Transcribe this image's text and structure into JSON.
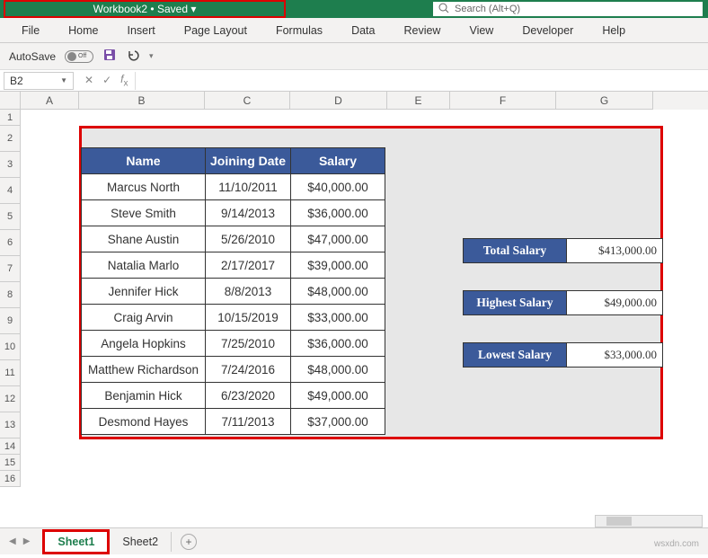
{
  "titlebar": {
    "text": "Workbook2 • Saved ▾"
  },
  "search": {
    "placeholder": "Search (Alt+Q)"
  },
  "ribbon": {
    "tabs": [
      "File",
      "Home",
      "Insert",
      "Page Layout",
      "Formulas",
      "Data",
      "Review",
      "View",
      "Developer",
      "Help"
    ]
  },
  "qat": {
    "autosave_label": "AutoSave",
    "autosave_state": "Off"
  },
  "namebox": {
    "value": "B2"
  },
  "columns": [
    "A",
    "B",
    "C",
    "D",
    "E",
    "F",
    "G"
  ],
  "row_numbers": [
    "1",
    "2",
    "3",
    "4",
    "5",
    "6",
    "7",
    "8",
    "9",
    "10",
    "11",
    "12",
    "13",
    "14",
    "15",
    "16"
  ],
  "table": {
    "headers": {
      "name": "Name",
      "joining": "Joining Date",
      "salary": "Salary"
    },
    "rows": [
      {
        "name": "Marcus North",
        "joining": "11/10/2011",
        "salary": "$40,000.00"
      },
      {
        "name": "Steve Smith",
        "joining": "9/14/2013",
        "salary": "$36,000.00"
      },
      {
        "name": "Shane Austin",
        "joining": "5/26/2010",
        "salary": "$47,000.00"
      },
      {
        "name": "Natalia Marlo",
        "joining": "2/17/2017",
        "salary": "$39,000.00"
      },
      {
        "name": "Jennifer Hick",
        "joining": "8/8/2013",
        "salary": "$48,000.00"
      },
      {
        "name": "Craig Arvin",
        "joining": "10/15/2019",
        "salary": "$33,000.00"
      },
      {
        "name": "Angela Hopkins",
        "joining": "7/25/2010",
        "salary": "$36,000.00"
      },
      {
        "name": "Matthew Richardson",
        "joining": "7/24/2016",
        "salary": "$48,000.00"
      },
      {
        "name": "Benjamin Hick",
        "joining": "6/23/2020",
        "salary": "$49,000.00"
      },
      {
        "name": "Desmond Hayes",
        "joining": "7/11/2013",
        "salary": "$37,000.00"
      }
    ]
  },
  "stats": {
    "total": {
      "label": "Total Salary",
      "value": "$413,000.00"
    },
    "highest": {
      "label": "Highest Salary",
      "value": "$49,000.00"
    },
    "lowest": {
      "label": "Lowest Salary",
      "value": "$33,000.00"
    }
  },
  "sheets": {
    "active": "Sheet1",
    "other": "Sheet2"
  },
  "watermark": "wsxdn.com"
}
